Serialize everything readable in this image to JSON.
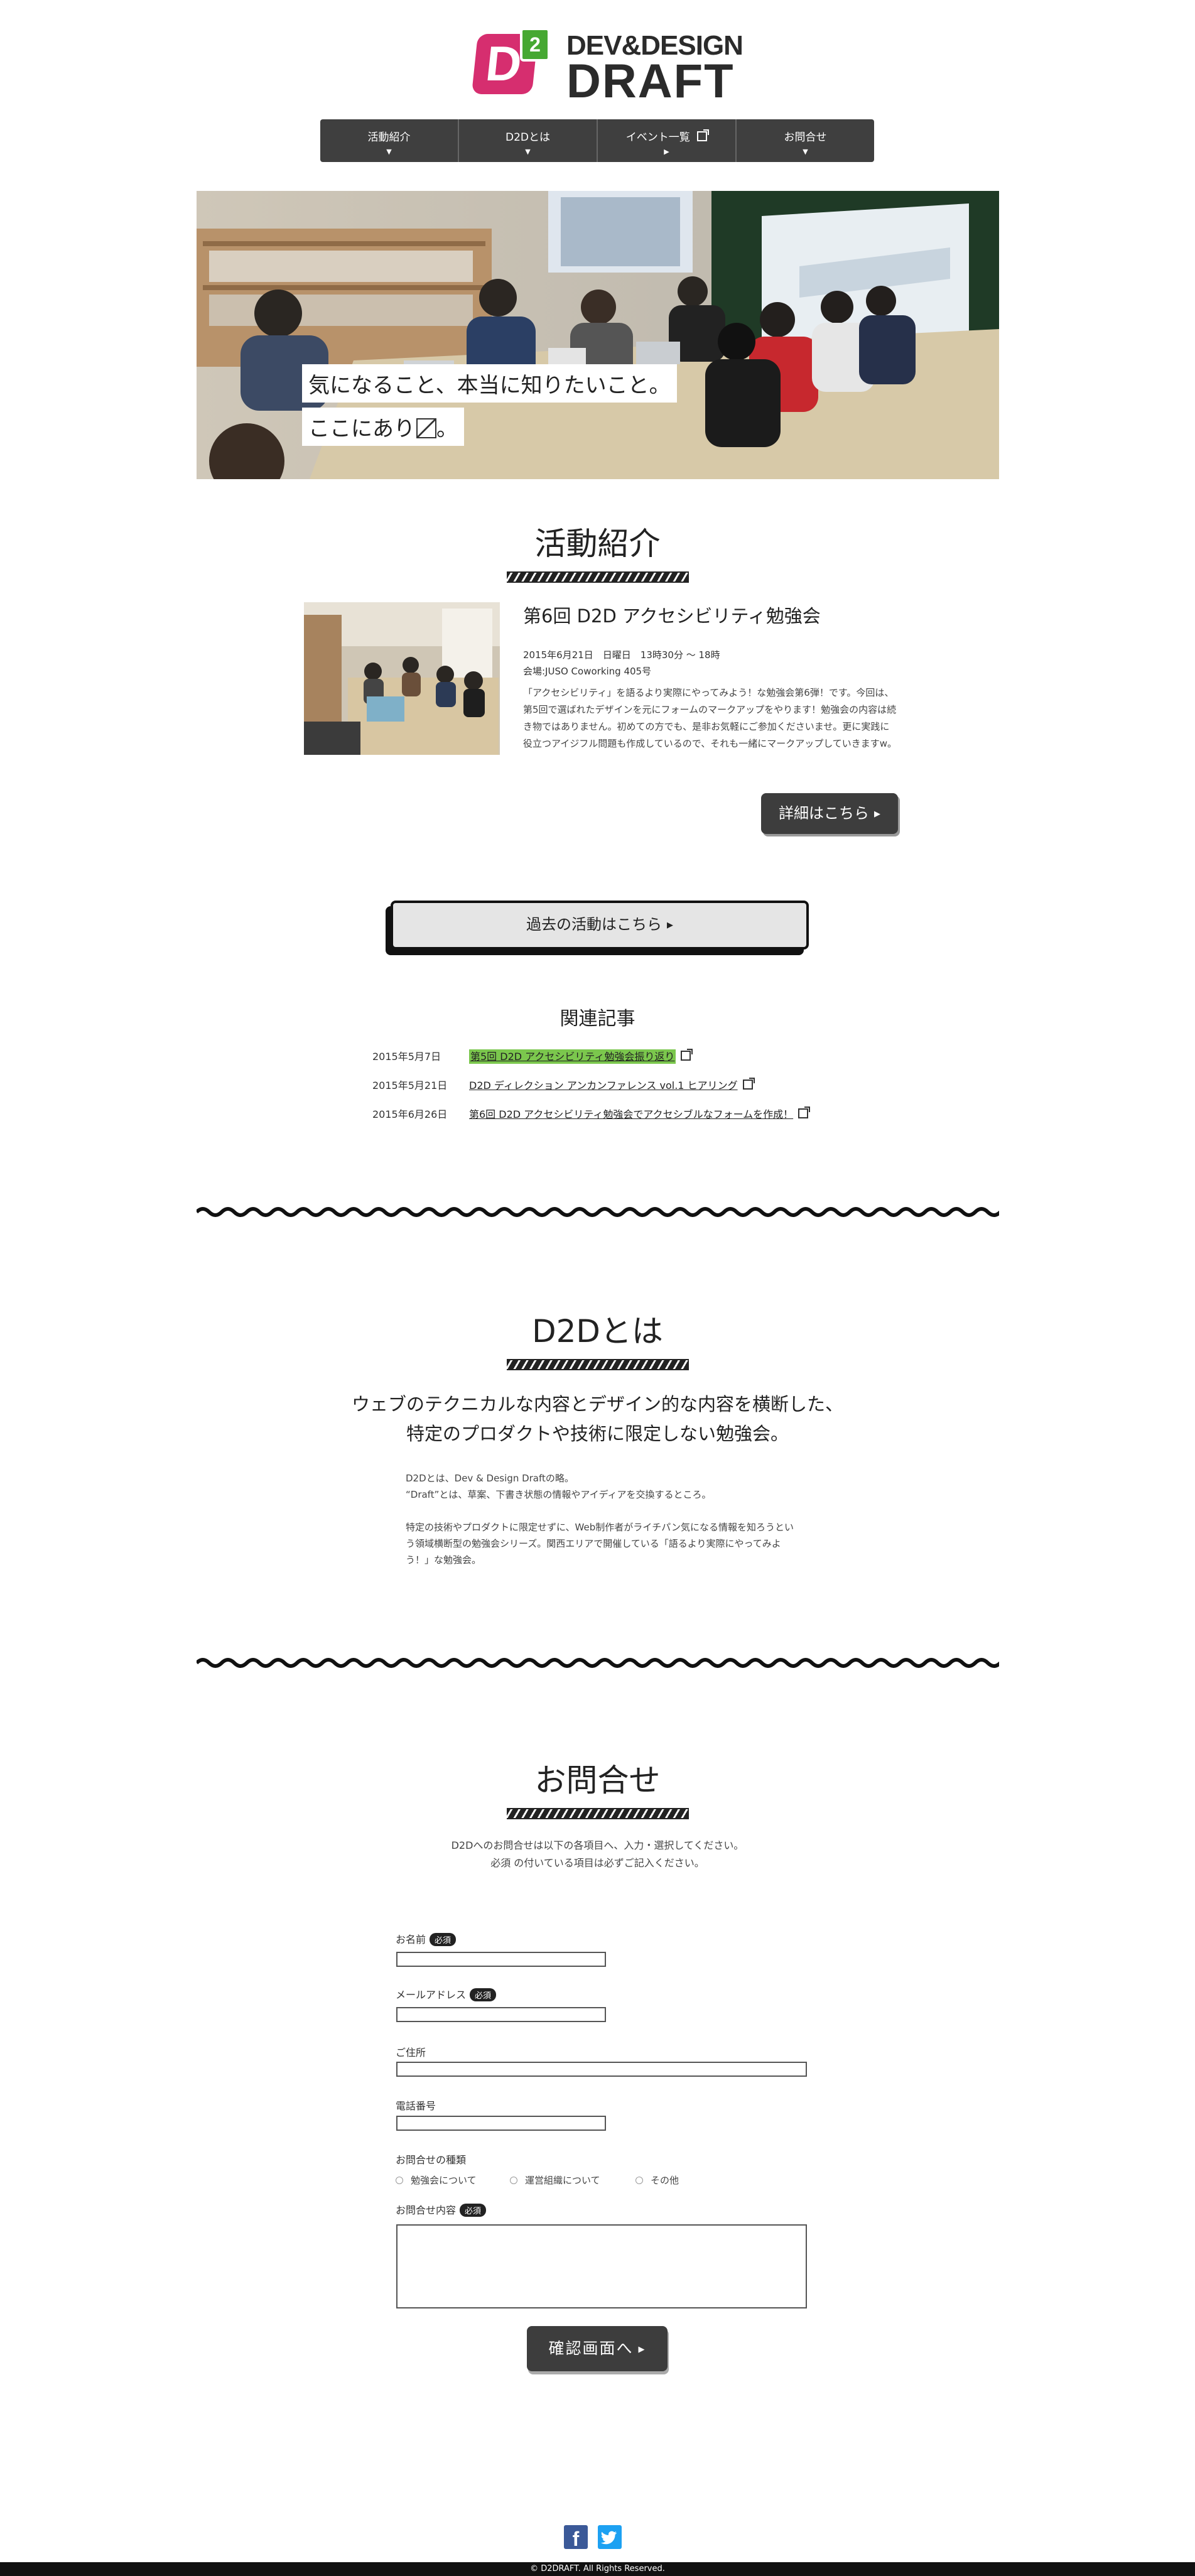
{
  "header": {
    "logo_badge": "2",
    "logo_mark": "D",
    "logo_line1": "DEV&DESIGN",
    "logo_line2": "DRAFT"
  },
  "nav": {
    "items": [
      {
        "label": "活動紹介",
        "icon": "arrow-down"
      },
      {
        "label": "D2Dとは",
        "icon": "arrow-down"
      },
      {
        "label": "イベント一覧",
        "icon": "external-link"
      },
      {
        "label": "お問合せ",
        "icon": "arrow-down"
      }
    ]
  },
  "hero": {
    "caption_line1": "気になること、本当に知りたいこと。",
    "caption_line2": "ここにあり",
    "caption_line2_end": "。"
  },
  "activity": {
    "heading": "活動紹介",
    "title": "第6回 D2D アクセシビリティ勉強会",
    "date": "2015年6月21日　日曜日　13時30分 〜 18時",
    "venue": "会場:JUSO Coworking 405号",
    "description": "「アクセシビリティ」を語るより実際にやってみよう！な勉強会第6弾！です。今回は、第5回で選ばれたデザインを元にフォームのマークアップをやります！勉強会の内容は続き物ではありません。初めての方でも、是非お気軽にご参加くださいませ。更に実践に役立つアイジフル問題も作成しているので、それも一緒にマークアップしていきますw。",
    "detail_button": "詳細はこちら",
    "past_button": "過去の活動はこちら"
  },
  "related": {
    "title": "関連記事",
    "items": [
      {
        "date": "2015年5月7日",
        "title": "第5回 D2D アクセシビリティ勉強会振り返り",
        "highlighted": true
      },
      {
        "date": "2015年5月21日",
        "title": "D2D ディレクション アンカンファレンス vol.1 ヒアリング",
        "highlighted": false
      },
      {
        "date": "2015年6月26日",
        "title": "第6回 D2D アクセシビリティ勉強会でアクセシブルなフォームを作成！",
        "highlighted": false
      }
    ]
  },
  "about": {
    "heading": "D2Dとは",
    "lead1": "ウェブのテクニカルな内容とデザイン的な内容を横断した、",
    "lead2": "特定のプロダクトや技術に限定しない勉強会。",
    "p1_line1": "D2Dとは、Dev & Design Draftの略。",
    "p1_line2": "“Draft”とは、草案、下書き状態の情報やアイディアを交換するところ。",
    "p2": "特定の技術やプロダクトに限定せずに、Web制作者がライチパン気になる情報を知ろうという領域横断型の勉強会シリーズ。関西エリアで開催している「語るより実際にやってみよう！」な勉強会。"
  },
  "contact": {
    "heading": "お問合せ",
    "intro1": "D2Dへのお問合せは以下の各項目へ、入力・選択してください。",
    "intro2": "必須 の付いている項目は必ずご記入ください。",
    "required_badge": "必須",
    "fields": {
      "name": "お名前",
      "email": "メールアドレス",
      "address": "ご住所",
      "phone": "電話番号",
      "type": "お問合せの種類",
      "message": "お問合せ内容"
    },
    "type_options": [
      "勉強会について",
      "運営組織について",
      "その他"
    ],
    "confirm_button": "確認画面へ"
  },
  "footer": {
    "copyright": "© D2DRAFT. All Rights Reserved."
  },
  "colors": {
    "brand_pink": "#d62e6f",
    "brand_green": "#46a832",
    "nav_bg": "#3f3f3f",
    "highlight_green": "#7bc74d"
  }
}
